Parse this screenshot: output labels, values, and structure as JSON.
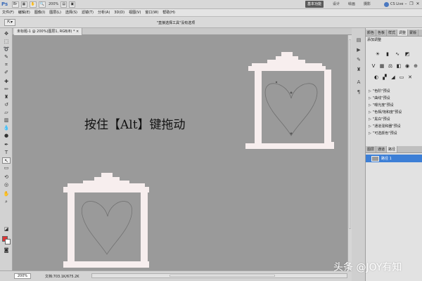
{
  "app": {
    "logo": "Ps",
    "zoom": "200%",
    "workspaces": [
      "基本功能",
      "设计",
      "绘画",
      "摄影"
    ],
    "cs_live": "CS Live"
  },
  "menu": [
    "文件(F)",
    "编辑(E)",
    "图像(I)",
    "图层(L)",
    "选择(S)",
    "滤镜(T)",
    "分析(A)",
    "3D(D)",
    "视图(V)",
    "窗口(W)",
    "帮助(H)"
  ],
  "options": {
    "hint": "\"直接选择工具\"没有选项"
  },
  "document": {
    "tab_label": "未标题-1 @ 200%(图层1, RGB/8) * ×",
    "canvas_text": "按住【Alt】键拖动"
  },
  "status": {
    "zoom": "200%",
    "doc_info": "文档:703.1K/675.2K"
  },
  "panels": {
    "tabs_top": [
      "颜色",
      "色板",
      "样式",
      "调整",
      "蒙版"
    ],
    "active_top": "调整",
    "adjustments_title": "添加调整",
    "presets": [
      "\"色阶\"预设",
      "\"曲线\"预设",
      "\"曝光度\"预设",
      "\"色相/饱和度\"预设",
      "\"黑白\"预设",
      "\"通道混和器\"预设",
      "\"可选颜色\"预设"
    ],
    "tabs_layers": [
      "图层",
      "通道",
      "路径"
    ],
    "active_layers": "路径",
    "layer_name": "路径 1"
  },
  "colors": {
    "foreground": "#e03434",
    "background": "#ffffff",
    "selection": "#3d7fd6",
    "frame": "#f7eeee"
  },
  "watermark": "头条 @JOY有知"
}
